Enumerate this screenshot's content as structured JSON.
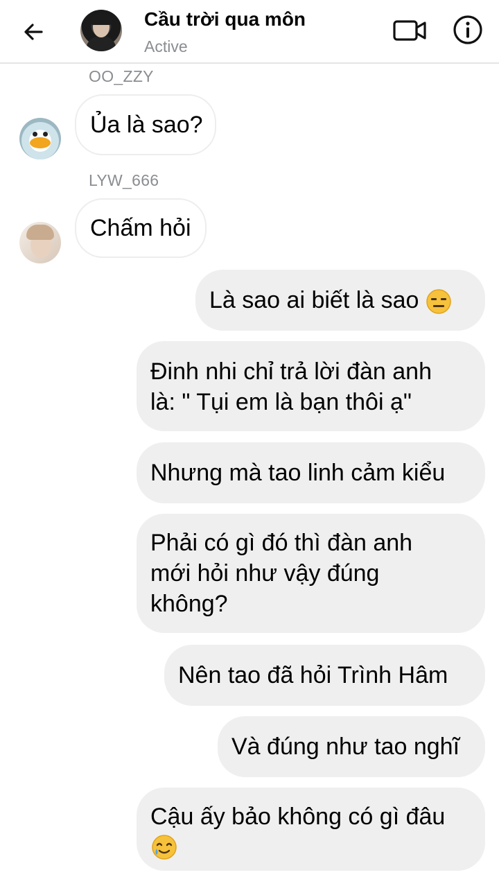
{
  "header": {
    "title": "Cầu trời qua môn",
    "status": "Active"
  },
  "icons": {
    "back": "arrow-left-icon",
    "video": "video-camera-icon",
    "info": "info-icon"
  },
  "messages": [
    {
      "sender": "OO_ZZY",
      "text": "Ủa là sao?",
      "direction": "incoming"
    },
    {
      "sender": "LYW_666",
      "text": "Chấm hỏi",
      "direction": "incoming"
    },
    {
      "text": "Là sao ai biết là sao",
      "emoji": "expressionless-face-emoji",
      "direction": "outgoing"
    },
    {
      "lines": [
        "Đinh nhi chỉ trả lời đàn anh",
        "là: \" Tụi em là bạn thôi ạ\""
      ],
      "direction": "outgoing"
    },
    {
      "text": "Nhưng mà tao linh cảm kiểu",
      "direction": "outgoing"
    },
    {
      "lines": [
        "Phải có gì đó thì đàn anh",
        "mới hỏi như vậy đúng",
        "không?"
      ],
      "direction": "outgoing"
    },
    {
      "text": "Nên tao đã hỏi Trình Hâm",
      "direction": "outgoing"
    },
    {
      "text": "Và đúng như tao nghĩ",
      "direction": "outgoing"
    },
    {
      "lines": [
        "Cậu ấy bảo không có gì đâu"
      ],
      "emoji": "smiling-face-with-tear-emoji",
      "direction": "outgoing"
    }
  ],
  "colors": {
    "outgoing_bubble": "#efefef",
    "incoming_border": "#ededed",
    "secondary_text": "#8a8d91"
  }
}
